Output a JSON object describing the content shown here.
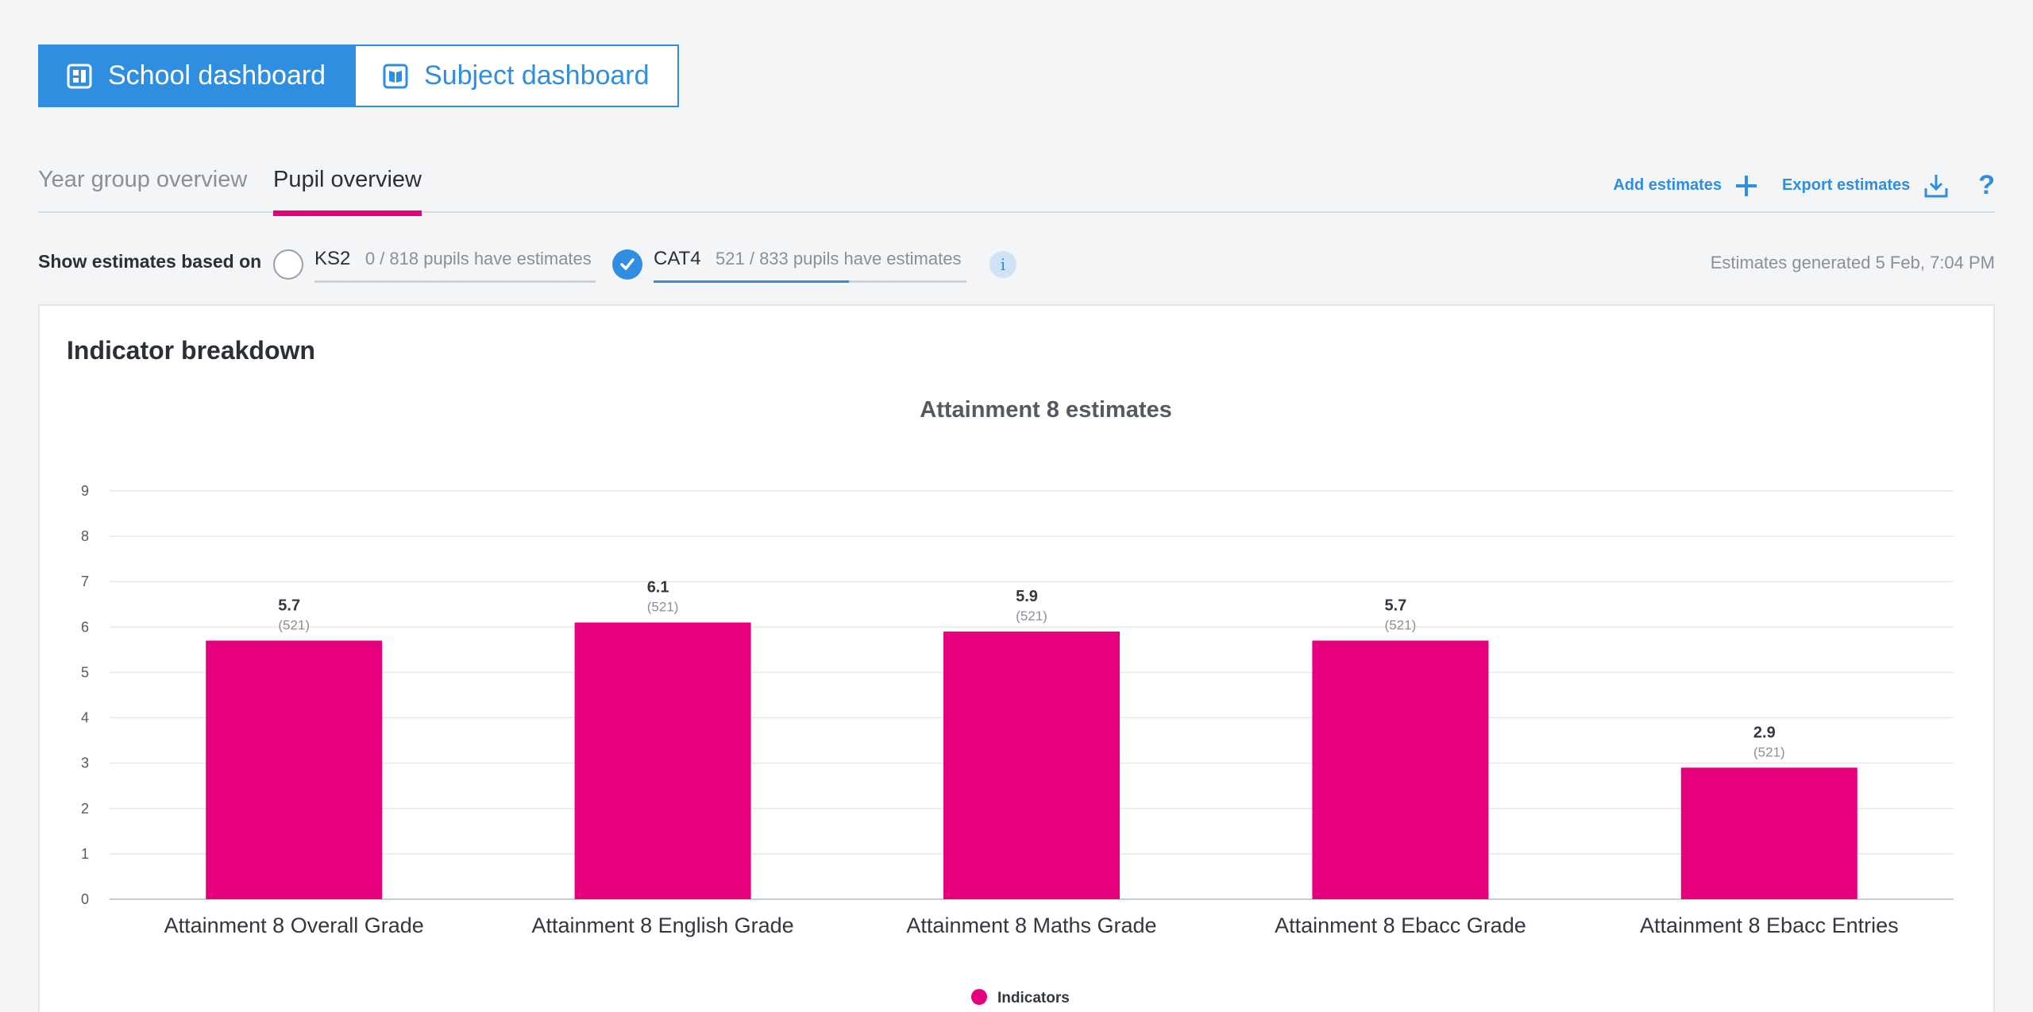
{
  "dashboards": {
    "school_label": "School dashboard",
    "subject_label": "Subject dashboard",
    "school_icon": "dashboard-layout-icon",
    "subject_icon": "book-icon"
  },
  "tabs": {
    "year_group": "Year group overview",
    "pupil": "Pupil overview"
  },
  "actions": {
    "add_estimates": "Add estimates",
    "export_estimates": "Export estimates",
    "help": "?"
  },
  "estimates": {
    "label": "Show estimates based on",
    "ks2": {
      "name": "KS2",
      "count_text": "0 / 818 pupils have estimates",
      "fraction": 0.0,
      "selected": false
    },
    "cat4": {
      "name": "CAT4",
      "count_text": "521 / 833 pupils have estimates",
      "fraction": 0.6255,
      "selected": true
    },
    "info": "i",
    "generated": "Estimates generated 5 Feb, 7:04 PM"
  },
  "panel": {
    "title": "Indicator breakdown"
  },
  "colors": {
    "accent": "#2f8ee0",
    "bar": "#e6007e",
    "tab_underline": "#e6007e"
  },
  "chart_data": {
    "type": "bar",
    "title": "Attainment 8 estimates",
    "categories": [
      "Attainment 8 Overall Grade",
      "Attainment 8 English Grade",
      "Attainment 8 Maths Grade",
      "Attainment 8 Ebacc Grade",
      "Attainment 8 Ebacc Entries"
    ],
    "series": [
      {
        "name": "Indicators",
        "values": [
          5.7,
          6.1,
          5.9,
          5.7,
          2.9
        ],
        "counts": [
          "(521)",
          "(521)",
          "(521)",
          "(521)",
          "(521)"
        ]
      }
    ],
    "value_labels": [
      "5.7",
      "6.1",
      "5.9",
      "5.7",
      "2.9"
    ],
    "yticks": [
      "0",
      "1",
      "2",
      "3",
      "4",
      "5",
      "6",
      "7",
      "8",
      "9"
    ],
    "ylim": [
      0,
      9
    ],
    "grid": true,
    "legend": "bottom-center"
  }
}
